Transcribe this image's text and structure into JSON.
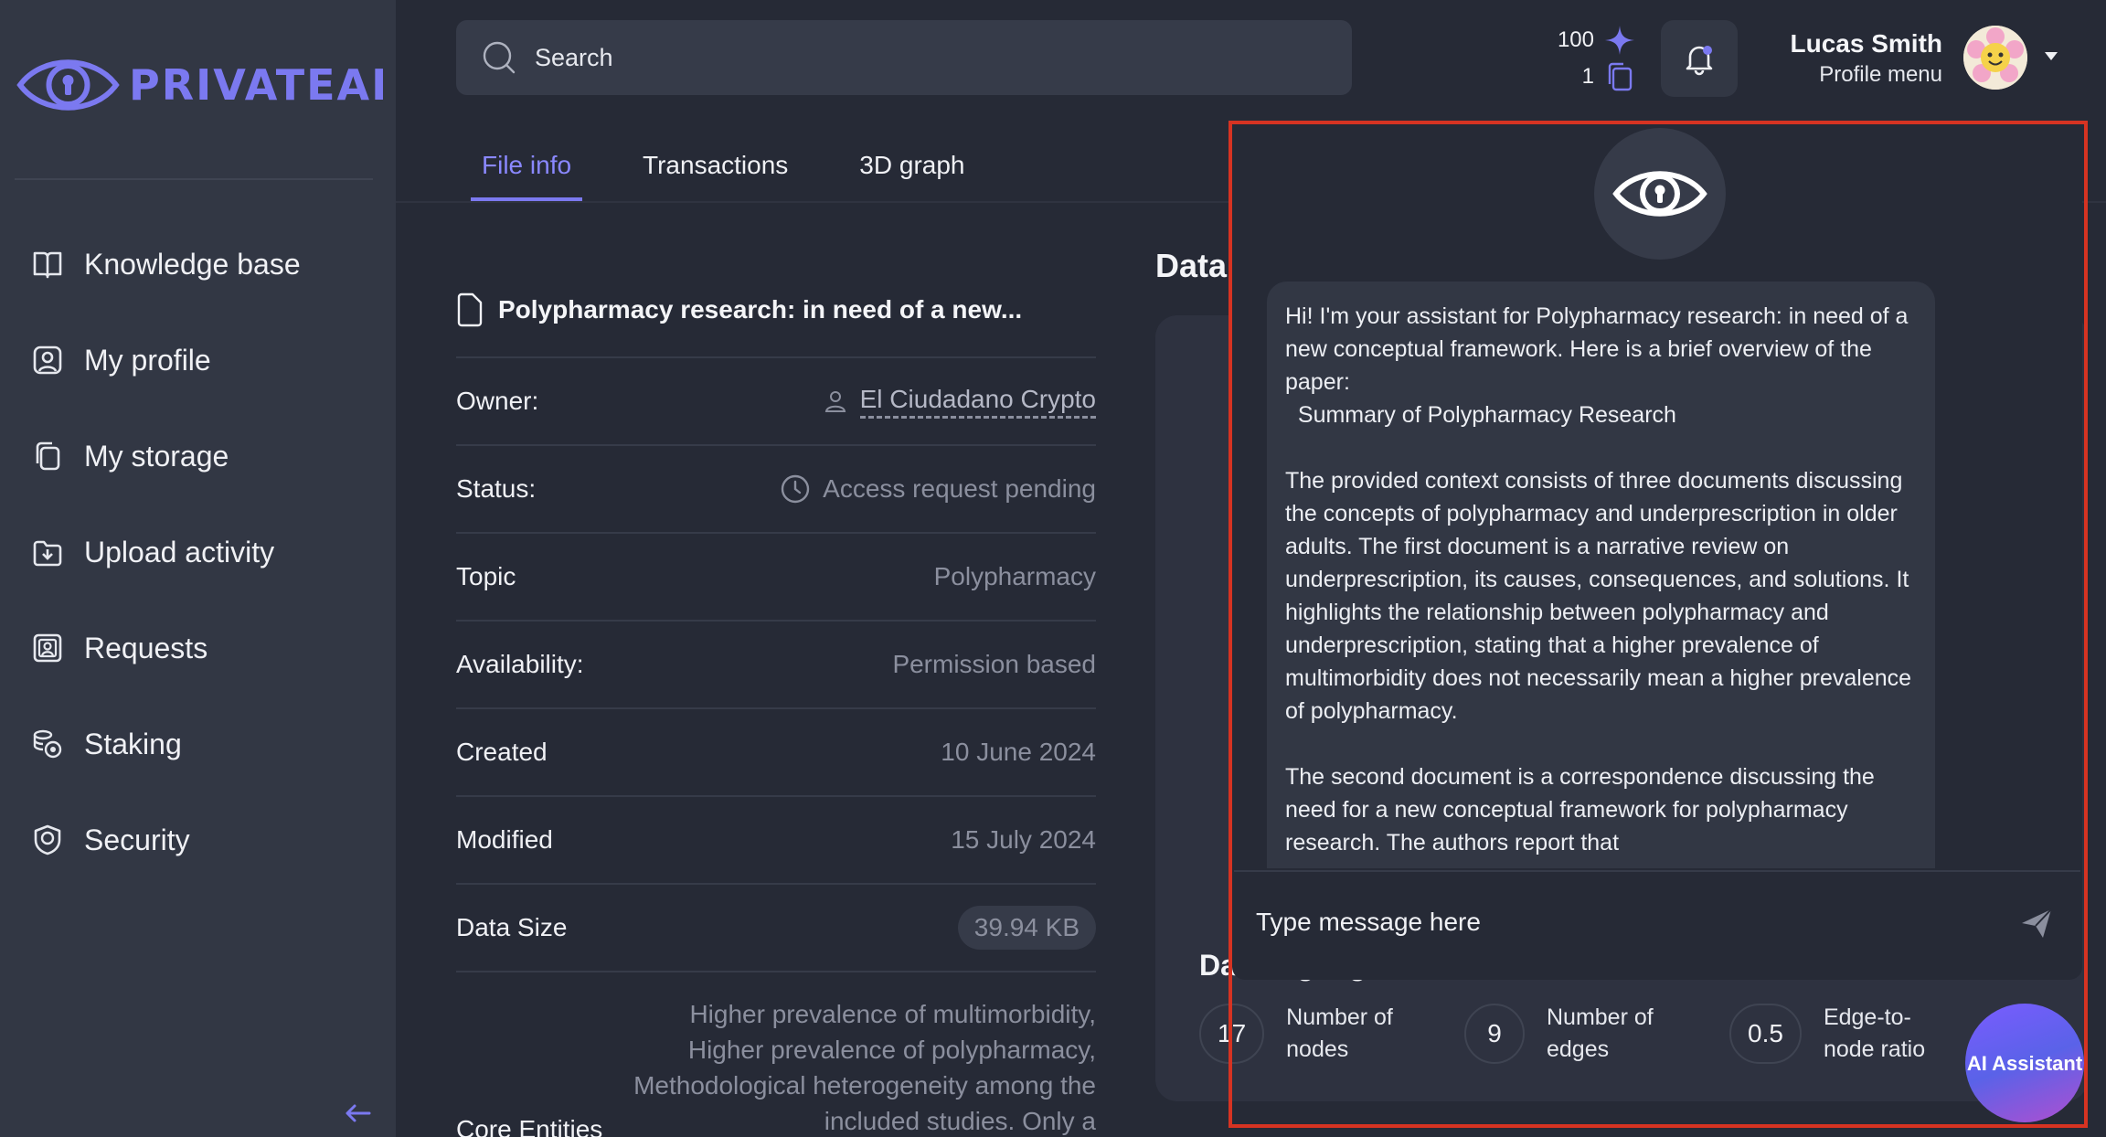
{
  "brand": {
    "name": "PRIVATEAI"
  },
  "sidebar": {
    "items": [
      {
        "label": "Knowledge base",
        "icon": "book-icon"
      },
      {
        "label": "My profile",
        "icon": "user-card-icon"
      },
      {
        "label": "My storage",
        "icon": "copy-icon"
      },
      {
        "label": "Upload activity",
        "icon": "download-folder-icon"
      },
      {
        "label": "Requests",
        "icon": "contact-card-icon"
      },
      {
        "label": "Staking",
        "icon": "coins-icon"
      },
      {
        "label": "Security",
        "icon": "shield-icon"
      }
    ]
  },
  "search": {
    "placeholder": "Search"
  },
  "credits": {
    "sparks": "100",
    "docs": "1"
  },
  "user": {
    "name": "Lucas Smith",
    "menu_label": "Profile menu"
  },
  "tabs": [
    {
      "label": "File info",
      "active": true
    },
    {
      "label": "Transactions",
      "active": false
    },
    {
      "label": "3D graph",
      "active": false
    }
  ],
  "file": {
    "title": "Polypharmacy research: in need of a new...",
    "rows": {
      "owner": {
        "key": "Owner:",
        "value": "El Ciudadano Crypto"
      },
      "status": {
        "key": "Status:",
        "value": "Access request pending"
      },
      "topic": {
        "key": "Topic",
        "value": "Polypharmacy"
      },
      "availability": {
        "key": "Availability:",
        "value": "Permission based"
      },
      "created": {
        "key": "Created",
        "value": "10 June 2024"
      },
      "modified": {
        "key": "Modified",
        "value": "15 July 2024"
      },
      "size": {
        "key": "Data Size",
        "value": "39.94 KB"
      },
      "core": {
        "key": "Core Entities",
        "value": "Higher prevalence of multimorbidity, Higher prevalence of polypharmacy, Methodological heterogeneity among the included studies. Only a"
      }
    }
  },
  "data_card": {
    "title": "Data",
    "highlights_title": "Data highlights",
    "metrics": [
      {
        "value": "17",
        "label": "Number of nodes"
      },
      {
        "value": "9",
        "label": "Number of edges"
      },
      {
        "value": "0.5",
        "label": "Edge-to-node ratio"
      }
    ]
  },
  "assistant": {
    "message": "Hi! I'm your assistant for Polypharmacy research: in need of a new conceptual framework. Here is a brief overview of the paper:\n  Summary of Polypharmacy Research\n\nThe provided context consists of three documents discussing the concepts of polypharmacy and underprescription in older adults. The first document is a narrative review on underprescription, its causes, consequences, and solutions. It highlights the relationship between polypharmacy and underprescription, stating that a higher prevalence of multimorbidity does not necessarily mean a higher prevalence of polypharmacy.\n\nThe second document is a correspondence discussing the need for a new conceptual framework for polypharmacy research. The authors report that",
    "input_placeholder": "Type message here",
    "fab_label": "AI Assistant"
  },
  "colors": {
    "accent": "#7b79f0",
    "highlight_border": "#d63322",
    "sidebar_bg": "#323744",
    "page_bg": "#262a36"
  }
}
